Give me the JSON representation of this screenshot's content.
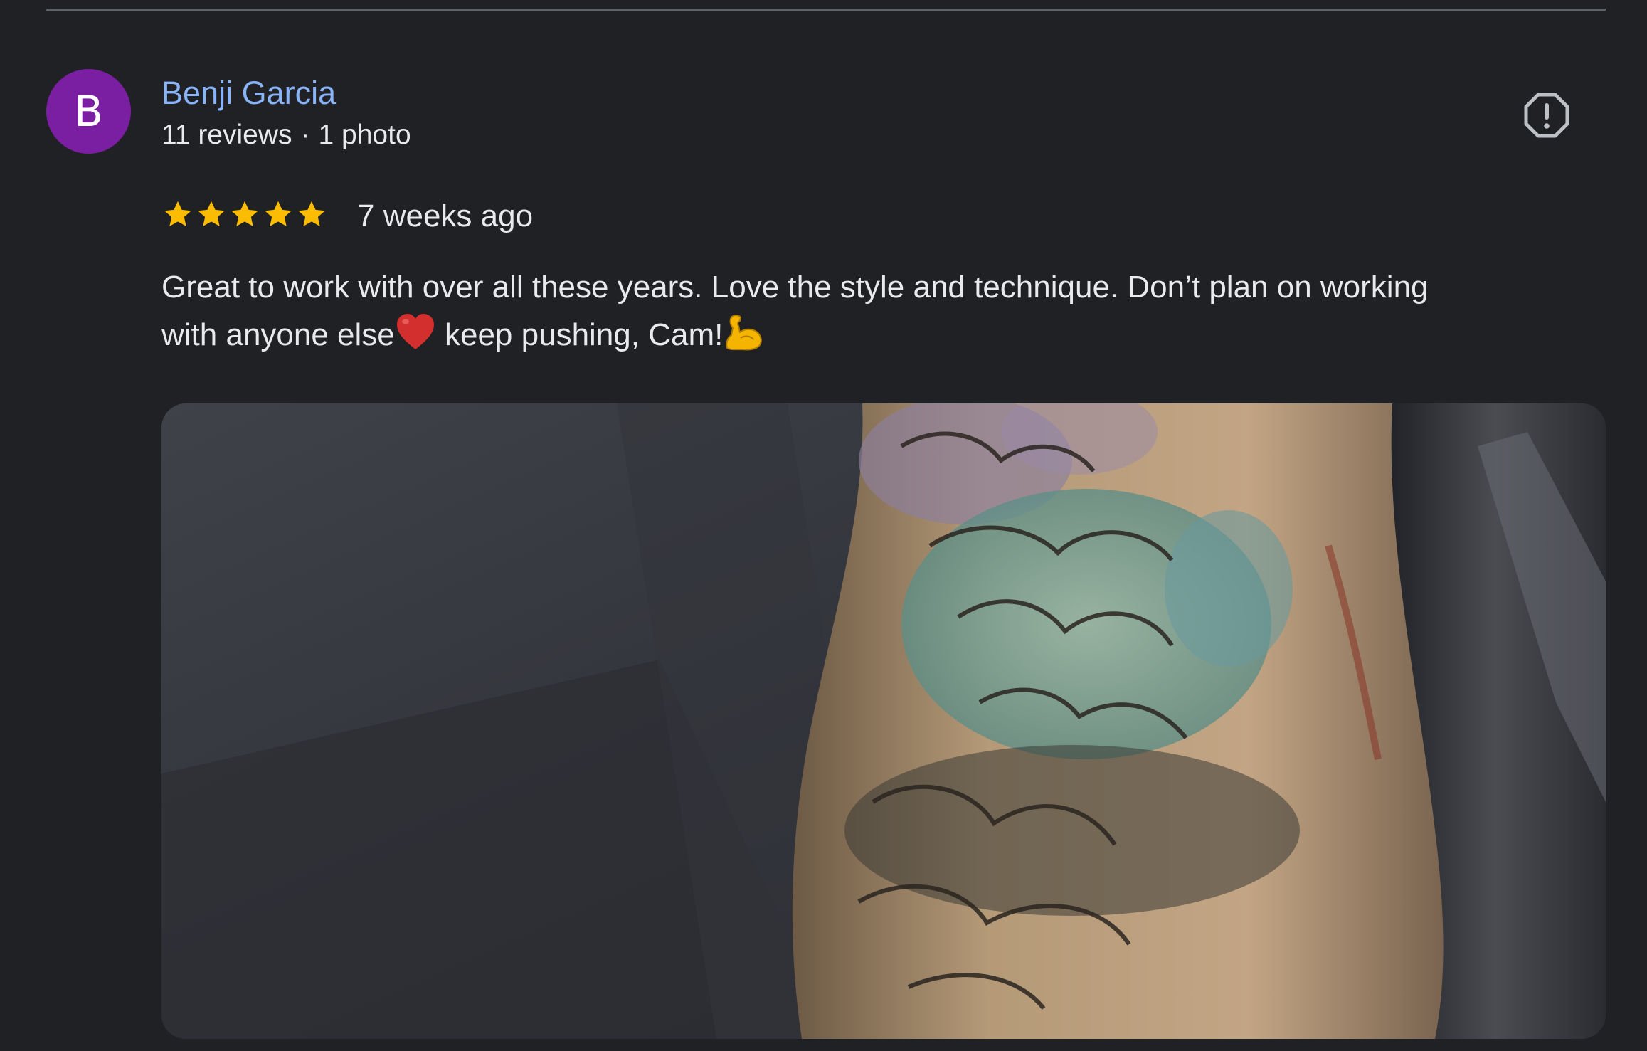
{
  "reviewer": {
    "name": "Benji Garcia",
    "initial": "B",
    "avatar_color": "#7b1fa2",
    "reviews_count": "11 reviews",
    "separator": "·",
    "photos_count": "1 photo"
  },
  "review": {
    "rating": 5,
    "max_rating": 5,
    "star_color": "#fbbc04",
    "date": "7 weeks ago",
    "text_line1": "Great to work with over all these years. Love the style and technique. Don’t plan on working",
    "text_line2_a": "with anyone else",
    "text_line2_b": " keep pushing, Cam!",
    "inline_icons": [
      "heart-icon",
      "flexed-biceps-icon"
    ]
  },
  "icons": {
    "report": "report-icon"
  },
  "colors": {
    "background": "#202124",
    "name_link": "#8ab4f8",
    "text": "#e8eaed",
    "divider": "#5f6368"
  }
}
